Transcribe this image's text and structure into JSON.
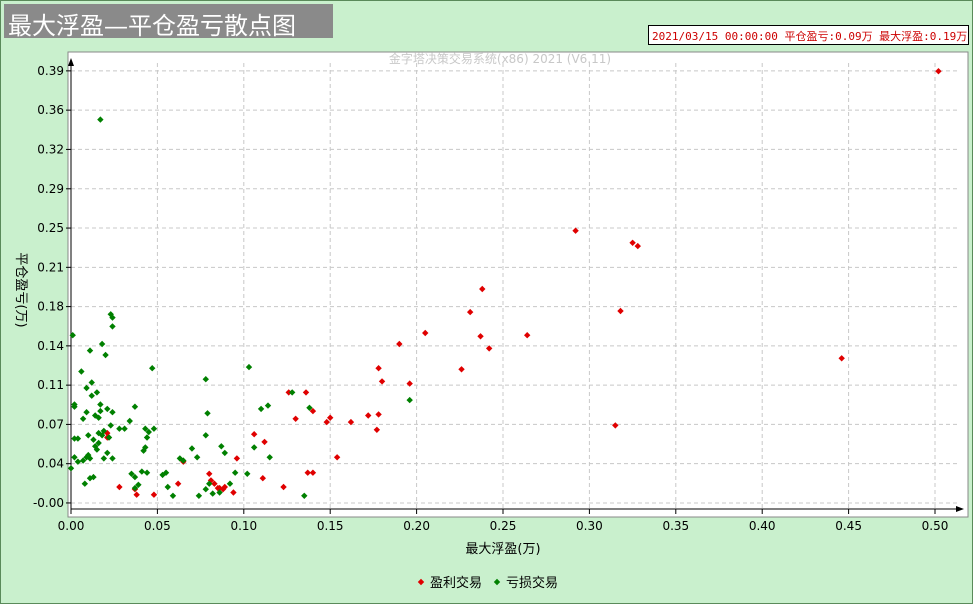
{
  "header": {
    "title": "最大浮盈—平仓盈亏散点图",
    "status": "2021/03/15 00:00:00 平仓盈亏:0.09万  最大浮盈:0.19万"
  },
  "chart_data": {
    "type": "scatter",
    "watermark": "金字塔决策交易系统(x86) 2021 (V6.11)",
    "xlabel": "最大浮盈(万)",
    "ylabel": "平仓盈亏(万)",
    "xlim": [
      0,
      0.5
    ],
    "ylim": [
      -0.01,
      0.39
    ],
    "xticks": [
      "0.00",
      "0.05",
      "0.10",
      "0.15",
      "0.20",
      "0.25",
      "0.30",
      "0.35",
      "0.40",
      "0.45",
      "0.50"
    ],
    "yticks": [
      "0.39",
      "0.36",
      "0.32",
      "0.29",
      "0.25",
      "0.21",
      "0.18",
      "0.14",
      "0.11",
      "0.07",
      "0.04",
      "-0.00"
    ],
    "ytick_values": [
      0.3883,
      0.3526,
      0.3169,
      0.2811,
      0.2454,
      0.2097,
      0.174,
      0.1383,
      0.1026,
      0.0669,
      0.0312,
      -0.0045
    ],
    "grid": true,
    "legend_position": "bottom-center",
    "series": [
      {
        "name": "盈利交易",
        "color": "#e00000",
        "points": [
          [
            0.502,
            0.388
          ],
          [
            0.446,
            0.127
          ],
          [
            0.328,
            0.229
          ],
          [
            0.325,
            0.232
          ],
          [
            0.318,
            0.17
          ],
          [
            0.315,
            0.066
          ],
          [
            0.292,
            0.243
          ],
          [
            0.264,
            0.148
          ],
          [
            0.242,
            0.136
          ],
          [
            0.238,
            0.19
          ],
          [
            0.237,
            0.147
          ],
          [
            0.231,
            0.169
          ],
          [
            0.226,
            0.117
          ],
          [
            0.205,
            0.15
          ],
          [
            0.196,
            0.104
          ],
          [
            0.19,
            0.14
          ],
          [
            0.18,
            0.106
          ],
          [
            0.178,
            0.118
          ],
          [
            0.178,
            0.076
          ],
          [
            0.177,
            0.062
          ],
          [
            0.172,
            0.075
          ],
          [
            0.162,
            0.069
          ],
          [
            0.154,
            0.037
          ],
          [
            0.15,
            0.073
          ],
          [
            0.148,
            0.069
          ],
          [
            0.14,
            0.079
          ],
          [
            0.14,
            0.023
          ],
          [
            0.137,
            0.023
          ],
          [
            0.136,
            0.096
          ],
          [
            0.13,
            0.072
          ],
          [
            0.126,
            0.096
          ],
          [
            0.123,
            0.01
          ],
          [
            0.112,
            0.051
          ],
          [
            0.111,
            0.018
          ],
          [
            0.106,
            0.058
          ],
          [
            0.096,
            0.036
          ],
          [
            0.094,
            0.005
          ],
          [
            0.089,
            0.01
          ],
          [
            0.088,
            0.008
          ],
          [
            0.086,
            0.009
          ],
          [
            0.085,
            0.009
          ],
          [
            0.083,
            0.013
          ],
          [
            0.081,
            0.016
          ],
          [
            0.08,
            0.022
          ],
          [
            0.065,
            0.033
          ],
          [
            0.062,
            0.013
          ],
          [
            0.048,
            0.003
          ],
          [
            0.038,
            0.003
          ],
          [
            0.037,
            0.008
          ],
          [
            0.028,
            0.01
          ],
          [
            0.021,
            0.055
          ],
          [
            0.021,
            0.059
          ]
        ]
      },
      {
        "name": "亏损交易",
        "color": "#008000",
        "points": [
          [
            0.017,
            0.344
          ],
          [
            0.023,
            0.167
          ],
          [
            0.024,
            0.164
          ],
          [
            0.024,
            0.156
          ],
          [
            0.001,
            0.148
          ],
          [
            0.018,
            0.14
          ],
          [
            0.011,
            0.134
          ],
          [
            0.02,
            0.13
          ],
          [
            0.047,
            0.118
          ],
          [
            0.006,
            0.115
          ],
          [
            0.078,
            0.108
          ],
          [
            0.012,
            0.105
          ],
          [
            0.103,
            0.119
          ],
          [
            0.128,
            0.096
          ],
          [
            0.009,
            0.1
          ],
          [
            0.015,
            0.096
          ],
          [
            0.012,
            0.093
          ],
          [
            0.002,
            0.085
          ],
          [
            0.002,
            0.083
          ],
          [
            0.017,
            0.085
          ],
          [
            0.021,
            0.081
          ],
          [
            0.024,
            0.078
          ],
          [
            0.017,
            0.079
          ],
          [
            0.009,
            0.078
          ],
          [
            0.014,
            0.075
          ],
          [
            0.037,
            0.083
          ],
          [
            0.016,
            0.073
          ],
          [
            0.007,
            0.072
          ],
          [
            0.034,
            0.07
          ],
          [
            0.043,
            0.063
          ],
          [
            0.045,
            0.06
          ],
          [
            0.048,
            0.063
          ],
          [
            0.023,
            0.066
          ],
          [
            0.019,
            0.061
          ],
          [
            0.016,
            0.059
          ],
          [
            0.018,
            0.057
          ],
          [
            0.022,
            0.055
          ],
          [
            0.031,
            0.063
          ],
          [
            0.01,
            0.057
          ],
          [
            0.013,
            0.053
          ],
          [
            0.002,
            0.054
          ],
          [
            0.004,
            0.054
          ],
          [
            0.016,
            0.05
          ],
          [
            0.014,
            0.047
          ],
          [
            0.015,
            0.044
          ],
          [
            0.021,
            0.041
          ],
          [
            0.028,
            0.063
          ],
          [
            0.044,
            0.055
          ],
          [
            0.043,
            0.046
          ],
          [
            0.042,
            0.043
          ],
          [
            0.106,
            0.046
          ],
          [
            0.078,
            0.057
          ],
          [
            0.079,
            0.077
          ],
          [
            0.11,
            0.081
          ],
          [
            0.114,
            0.084
          ],
          [
            0.138,
            0.082
          ],
          [
            0.196,
            0.089
          ],
          [
            0.115,
            0.037
          ],
          [
            0.095,
            0.023
          ],
          [
            0.102,
            0.022
          ],
          [
            0.087,
            0.047
          ],
          [
            0.089,
            0.041
          ],
          [
            0.002,
            0.037
          ],
          [
            0.007,
            0.034
          ],
          [
            0.009,
            0.037
          ],
          [
            0.01,
            0.039
          ],
          [
            0.011,
            0.036
          ],
          [
            0.004,
            0.033
          ],
          [
            0.024,
            0.036
          ],
          [
            0.019,
            0.036
          ],
          [
            0.063,
            0.036
          ],
          [
            0.065,
            0.034
          ],
          [
            0.073,
            0.037
          ],
          [
            0.035,
            0.022
          ],
          [
            0.037,
            0.019
          ],
          [
            0.041,
            0.024
          ],
          [
            0.044,
            0.023
          ],
          [
            0.053,
            0.021
          ],
          [
            0.055,
            0.023
          ],
          [
            0.0,
            0.027
          ],
          [
            0.011,
            0.018
          ],
          [
            0.013,
            0.019
          ],
          [
            0.008,
            0.013
          ],
          [
            0.039,
            0.012
          ],
          [
            0.037,
            0.009
          ],
          [
            0.056,
            0.01
          ],
          [
            0.059,
            0.002
          ],
          [
            0.074,
            0.002
          ],
          [
            0.078,
            0.008
          ],
          [
            0.082,
            0.004
          ],
          [
            0.086,
            0.005
          ],
          [
            0.08,
            0.013
          ],
          [
            0.092,
            0.013
          ],
          [
            0.135,
            0.002
          ],
          [
            0.07,
            0.045
          ]
        ]
      }
    ]
  }
}
